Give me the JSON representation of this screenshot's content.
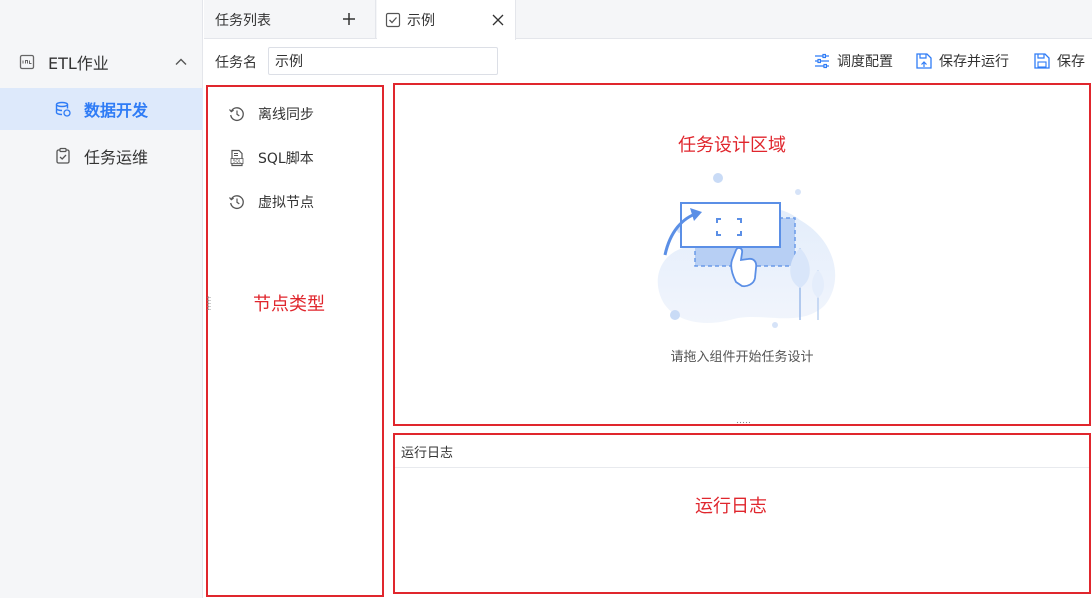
{
  "sidebar": {
    "group": {
      "label": "ETL作业",
      "icon": "etl-icon",
      "expanded": true
    },
    "items": [
      {
        "label": "数据开发",
        "icon": "database-icon",
        "active": true
      },
      {
        "label": "任务运维",
        "icon": "clipboard-check-icon",
        "active": false
      }
    ]
  },
  "tabs": [
    {
      "label": "任务列表",
      "action_icon": "plus-icon"
    },
    {
      "label": "示例",
      "icon": "task-check-icon",
      "action_icon": "close-icon",
      "active": true
    }
  ],
  "toolbar": {
    "task_name_label": "任务名",
    "task_name_value": "示例",
    "schedule_label": "调度配置",
    "save_run_label": "保存并运行",
    "save_label": "保存"
  },
  "node_panel": {
    "items": [
      {
        "label": "离线同步",
        "icon": "sync-icon"
      },
      {
        "label": "SQL脚本",
        "icon": "sql-script-icon"
      },
      {
        "label": "虚拟节点",
        "icon": "virtual-node-icon"
      }
    ],
    "annotation": "节点类型"
  },
  "design_panel": {
    "annotation": "任务设计区域",
    "empty_text": "请拖入组件开始任务设计"
  },
  "log_panel": {
    "header": "运行日志",
    "annotation": "运行日志"
  },
  "colors": {
    "accent": "#2f7cf6",
    "annotation_red": "#e0262d",
    "sidebar_bg": "#f5f6f8",
    "active_bg": "#dde9fb"
  }
}
